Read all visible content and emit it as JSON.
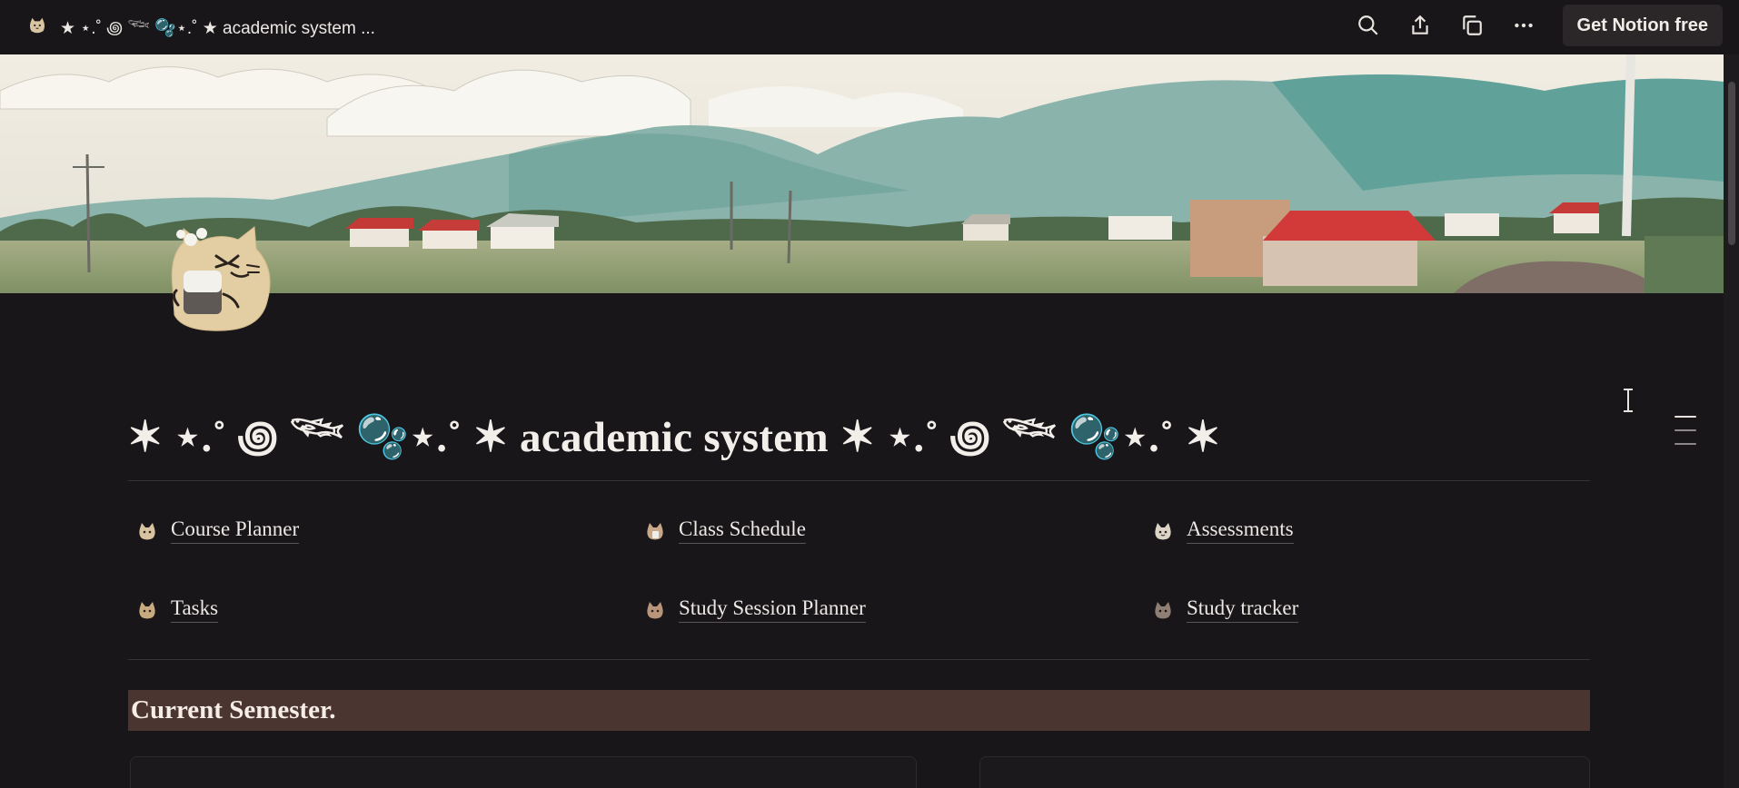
{
  "topbar": {
    "title": "★ ⋆.˚ ꩜ 𓆝 🫧⋆.˚ ★ academic system ...",
    "icons": [
      "cat-page-icon",
      "search-icon",
      "share-icon",
      "duplicate-icon",
      "more-icon"
    ],
    "cta_label": "Get Notion free"
  },
  "page": {
    "title": "✶ ⋆.˚ ꩜ 𓆝 🫧⋆.˚ ✶ academic system ✶ ⋆.˚ ꩜ 𓆝 🫧⋆.˚ ✶",
    "cover": "watercolor countryside landscape with mountains and red-roofed houses",
    "icon": "cat-with-drink-icon"
  },
  "links": [
    {
      "label": "Course Planner",
      "icon": "cat-face-icon"
    },
    {
      "label": "Class Schedule",
      "icon": "cat-face-icon"
    },
    {
      "label": "Assessments",
      "icon": "cat-face-icon"
    },
    {
      "label": "Tasks",
      "icon": "cat-face-icon"
    },
    {
      "label": "Study Session Planner",
      "icon": "cat-face-icon"
    },
    {
      "label": "Study tracker",
      "icon": "cat-face-icon"
    }
  ],
  "section": {
    "heading": "Current Semester."
  },
  "colors": {
    "background": "#191619",
    "heading_bg": "#4b3530",
    "text": "#ece8e4",
    "button_bg": "#2b2729"
  }
}
